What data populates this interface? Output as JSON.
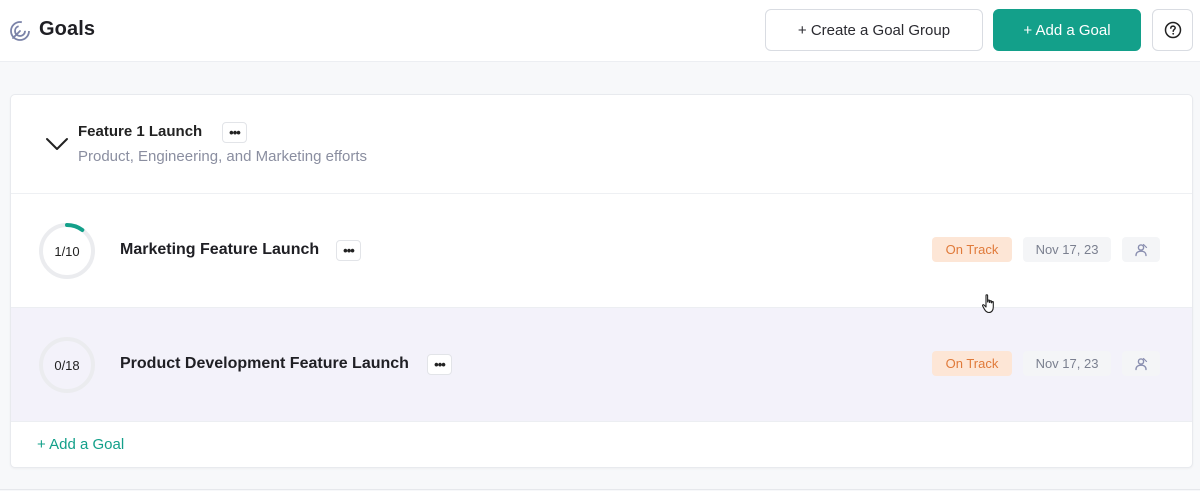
{
  "header": {
    "title": "Goals",
    "logo_icon": "goal-target-icon",
    "create_group_label": "+ Create a Goal Group",
    "add_goal_label": "+ Add a Goal",
    "help_icon": "help-circle-icon"
  },
  "group": {
    "title": "Feature 1 Launch",
    "subtitle": "Product, Engineering, and Marketing efforts",
    "menu_label": "•••",
    "collapse_icon": "chevron-down-icon",
    "goals": [
      {
        "progress_label": "1/10",
        "progress_fraction": 0.1,
        "title": "Marketing Feature Launch",
        "menu_label": "•••",
        "status": "On Track",
        "date": "Nov 17, 23",
        "owner_icon": "user-icon"
      },
      {
        "progress_label": "0/18",
        "progress_fraction": 0,
        "title": "Product Development Feature Launch",
        "menu_label": "•••",
        "status": "On Track",
        "date": "Nov 17, 23",
        "owner_icon": "user-icon"
      }
    ],
    "add_goal_label": "+ Add a Goal"
  },
  "colors": {
    "accent": "#13a08a",
    "status_bg": "#fde6d6",
    "status_text": "#e07a3a",
    "hover_row_bg": "#f3f2fa"
  }
}
